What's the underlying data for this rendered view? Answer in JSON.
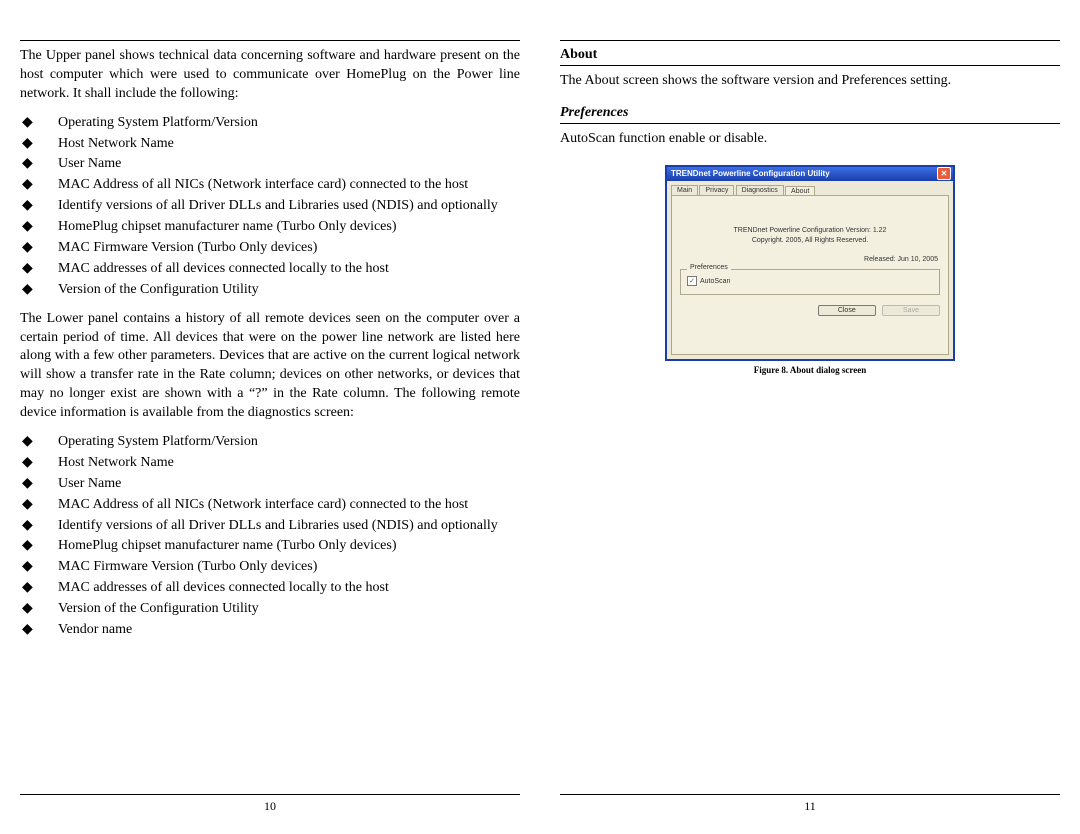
{
  "left": {
    "p1": "The Upper panel shows technical data concerning software and hardware present on the host computer which were used to communicate over HomePlug on the Power line network. It shall include the following:",
    "list1": [
      "Operating System Platform/Version",
      "Host Network Name",
      "User Name",
      "MAC Address of all NICs (Network interface card) connected to the host",
      "Identify versions of all Driver DLLs and Libraries used (NDIS) and optionally",
      "HomePlug chipset manufacturer name (Turbo Only devices)",
      "MAC Firmware Version (Turbo Only devices)",
      "MAC addresses of all devices connected locally to the host",
      "Version of the Configuration Utility"
    ],
    "p2": "The Lower panel contains a history of all remote devices seen on the computer over a certain period of time. All devices that were on the power line network are listed here along with a few other parameters. Devices that are active on the current logical network will show a transfer rate in the Rate column; devices on other networks, or devices that may no longer exist are shown with a “?” in the Rate column. The following remote device information is available from the diagnostics screen:",
    "list2": [
      "Operating System Platform/Version",
      "Host Network Name",
      "User Name",
      "MAC Address of all NICs (Network interface card) connected to the host",
      "Identify versions of all Driver DLLs and Libraries used (NDIS) and optionally",
      "HomePlug chipset manufacturer name (Turbo Only devices)",
      "MAC Firmware Version (Turbo Only devices)",
      "MAC addresses of all devices connected locally to the host",
      "Version of the Configuration Utility",
      "Vendor name"
    ],
    "pagenum": "10"
  },
  "right": {
    "about_title": "About",
    "about_text": "The About screen shows the software version and Preferences setting.",
    "prefs_title": "Preferences",
    "prefs_text": "AutoScan function enable or disable.",
    "caption": "Figure 8. About dialog screen",
    "pagenum": "11"
  },
  "dialog": {
    "title": "TRENDnet Powerline Configuration Utility",
    "tabs": [
      "Main",
      "Privacy",
      "Diagnostics",
      "About"
    ],
    "product_line": "TRENDnet Powerline Configuration     Version:   1.22",
    "copyright": "Copyright.  2005,  All Rights Reserved.",
    "released": "Released: Jun 10, 2005",
    "prefs_label": "Preferences",
    "autoscan_label": "AutoScan",
    "close_btn": "Close",
    "save_btn": "Save"
  }
}
